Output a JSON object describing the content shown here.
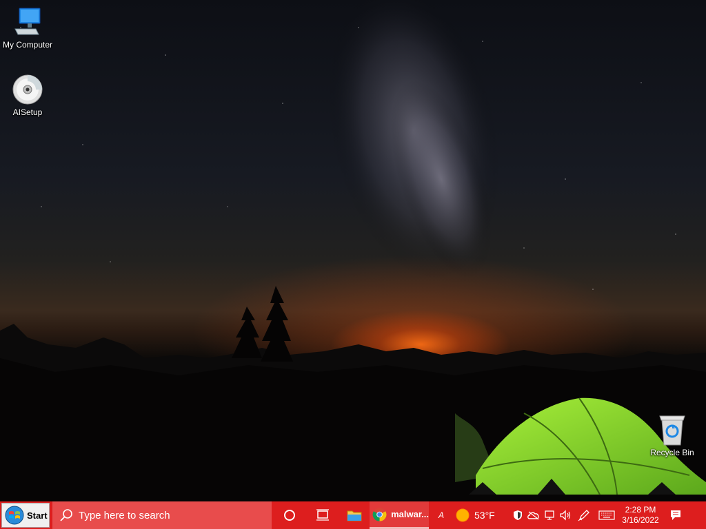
{
  "desktop": {
    "icons": [
      {
        "label": "My Computer",
        "icon": "computer-icon"
      },
      {
        "label": "AISetup",
        "icon": "cd-icon"
      },
      {
        "label": "Recycle Bin",
        "icon": "recycle-bin-icon"
      }
    ]
  },
  "taskbar": {
    "start_label": "Start",
    "search_placeholder": "Type here to search",
    "chrome_task_label": "malwar...",
    "hidden_app_label": "A",
    "weather_temp": "53°F",
    "clock_time": "2:28 PM",
    "clock_date": "3/16/2022"
  },
  "colors": {
    "taskbar": "#dd1e1e",
    "search_box": "#e84c4c",
    "tent": "#8fe02a"
  }
}
